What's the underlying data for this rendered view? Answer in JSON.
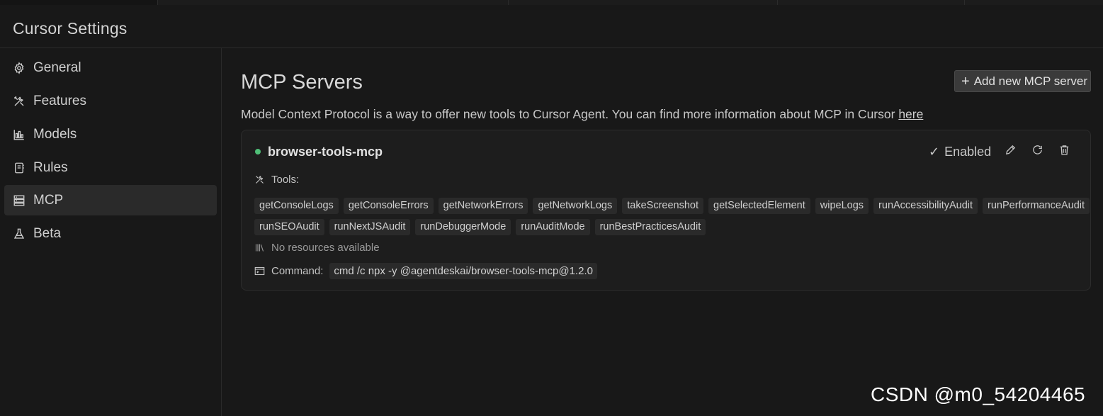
{
  "header": {
    "title": "Cursor Settings"
  },
  "sidebar": {
    "items": [
      {
        "label": "General",
        "icon": "gear-icon"
      },
      {
        "label": "Features",
        "icon": "tools-icon"
      },
      {
        "label": "Models",
        "icon": "bar-chart-icon"
      },
      {
        "label": "Rules",
        "icon": "notebook-icon"
      },
      {
        "label": "MCP",
        "icon": "server-icon",
        "active": true
      },
      {
        "label": "Beta",
        "icon": "flask-icon"
      }
    ]
  },
  "main": {
    "title": "MCP Servers",
    "add_button": "Add new MCP server",
    "description": "Model Context Protocol is a way to offer new tools to Cursor Agent. You can find more information about MCP in Cursor ",
    "description_link": "here",
    "server": {
      "name": "browser-tools-mcp",
      "status_color": "#4fbf77",
      "status": "Enabled",
      "tools_label": "Tools:",
      "tools_row1": [
        "getConsoleLogs",
        "getConsoleErrors",
        "getNetworkErrors",
        "getNetworkLogs",
        "takeScreenshot",
        "getSelectedElement",
        "wipeLogs",
        "runAccessibilityAudit",
        "runPerformanceAudit"
      ],
      "tools_row2": [
        "runSEOAudit",
        "runNextJSAudit",
        "runDebuggerMode",
        "runAuditMode",
        "runBestPracticesAudit"
      ],
      "resources": "No resources available",
      "command_label": "Command:",
      "command": "cmd /c npx -y @agentdeskai/browser-tools-mcp@1.2.0"
    }
  },
  "watermark": "CSDN @m0_54204465"
}
